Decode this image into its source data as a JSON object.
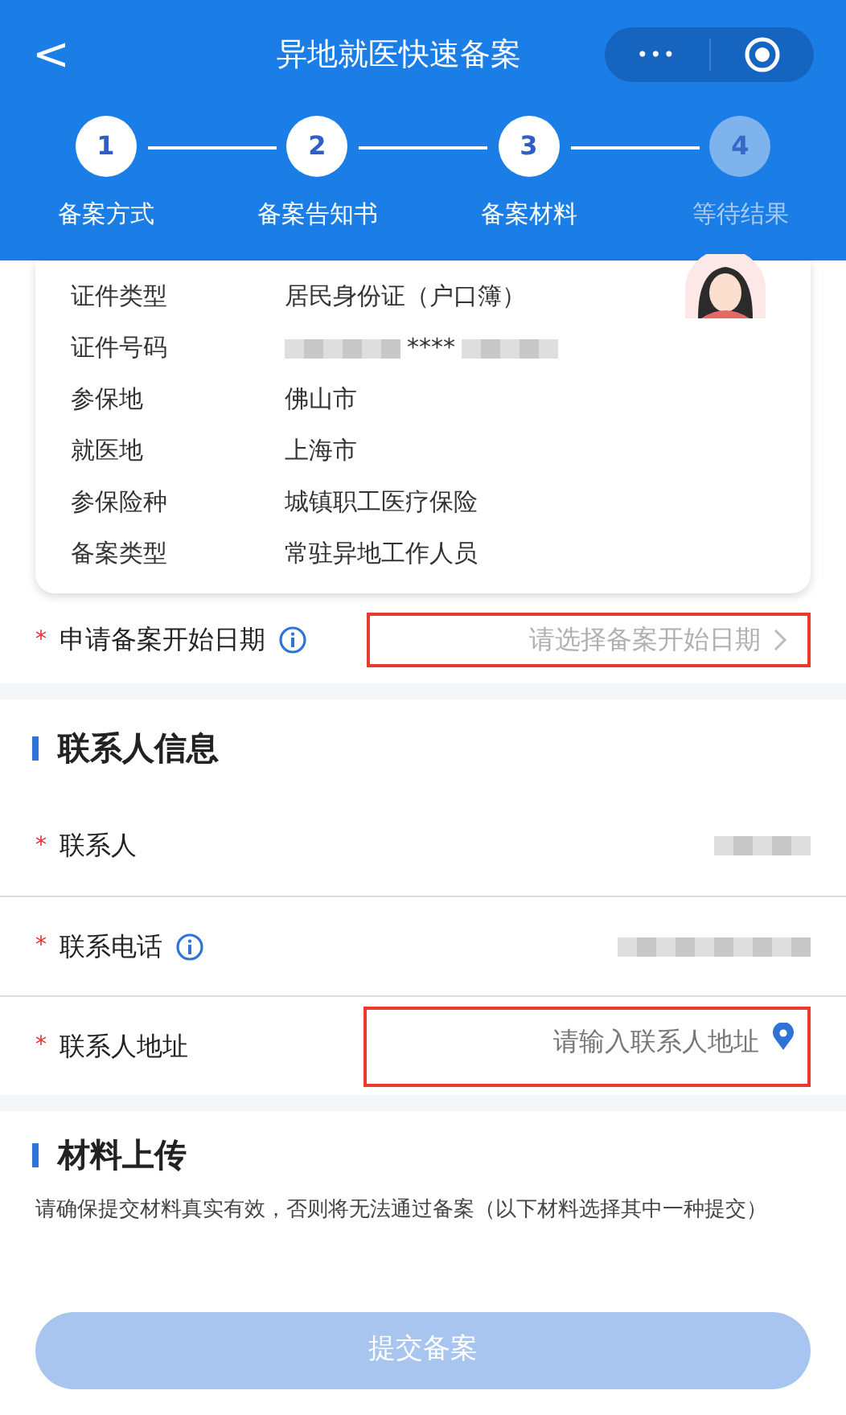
{
  "nav": {
    "back": "<",
    "title": "异地就医快速备案",
    "more": "•••"
  },
  "steps": [
    {
      "number": "1",
      "label": "备案方式",
      "completed": true
    },
    {
      "number": "2",
      "label": "备案告知书",
      "completed": true
    },
    {
      "number": "3",
      "label": "备案材料",
      "completed": true
    },
    {
      "number": "4",
      "label": "等待结果",
      "completed": false
    }
  ],
  "info_card": {
    "rows": [
      {
        "label": "证件类型",
        "value": "居民身份证（户口簿）",
        "kind": "text"
      },
      {
        "label": "证件号码",
        "value": "****",
        "kind": "masked"
      },
      {
        "label": "参保地",
        "value": "佛山市",
        "kind": "text"
      },
      {
        "label": "就医地",
        "value": "上海市",
        "kind": "text"
      },
      {
        "label": "参保险种",
        "value": "城镇职工医疗保险",
        "kind": "text"
      },
      {
        "label": "备案类型",
        "value": "常驻异地工作人员",
        "kind": "text"
      }
    ]
  },
  "start_date": {
    "required": "*",
    "label": "申请备案开始日期",
    "placeholder": "请选择备案开始日期",
    "highlighted": true
  },
  "contact_section": {
    "title": "联系人信息",
    "fields": [
      {
        "required": "*",
        "label": "联系人",
        "kind": "masked"
      },
      {
        "required": "*",
        "label": "联系电话",
        "kind": "masked_info"
      },
      {
        "required": "*",
        "label": "联系人地址",
        "kind": "address",
        "address_input": {
          "placeholder": "请输入联系人地址",
          "highlighted": true
        }
      }
    ]
  },
  "upload_section": {
    "title": "材料上传",
    "note": "请确保提交材料真实有效，否则将无法通过备案（以下材料选择其中一种提交）"
  },
  "submit": {
    "label": "提交备案",
    "disabled": true
  }
}
